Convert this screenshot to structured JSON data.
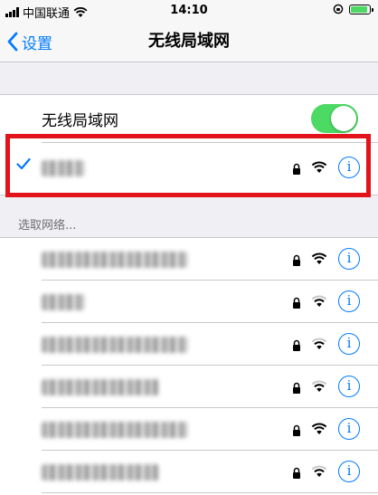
{
  "status_bar": {
    "carrier": "中国联通",
    "time": "14:10",
    "battery_level": 0.9
  },
  "nav": {
    "back_label": "设置",
    "title": "无线局域网"
  },
  "wifi_toggle": {
    "label": "无线局域网",
    "on": true
  },
  "connected_network": {
    "secured": true,
    "signal_level": 3
  },
  "section": {
    "choose_network_label": "选取网络..."
  },
  "networks": [
    {
      "secured": true,
      "signal_level": 3
    },
    {
      "secured": true,
      "signal_level": 2
    },
    {
      "secured": true,
      "signal_level": 2
    },
    {
      "secured": true,
      "signal_level": 2
    },
    {
      "secured": true,
      "signal_level": 3
    },
    {
      "secured": true,
      "signal_level": 2
    }
  ],
  "colors": {
    "accent": "#007aff",
    "toggle_on": "#4cd964",
    "highlight": "#e2131b",
    "background": "#efeff4"
  },
  "icons": [
    "wifi-icon",
    "lock-icon",
    "info-icon",
    "checkmark-icon",
    "chevron-left-icon",
    "battery-icon"
  ]
}
